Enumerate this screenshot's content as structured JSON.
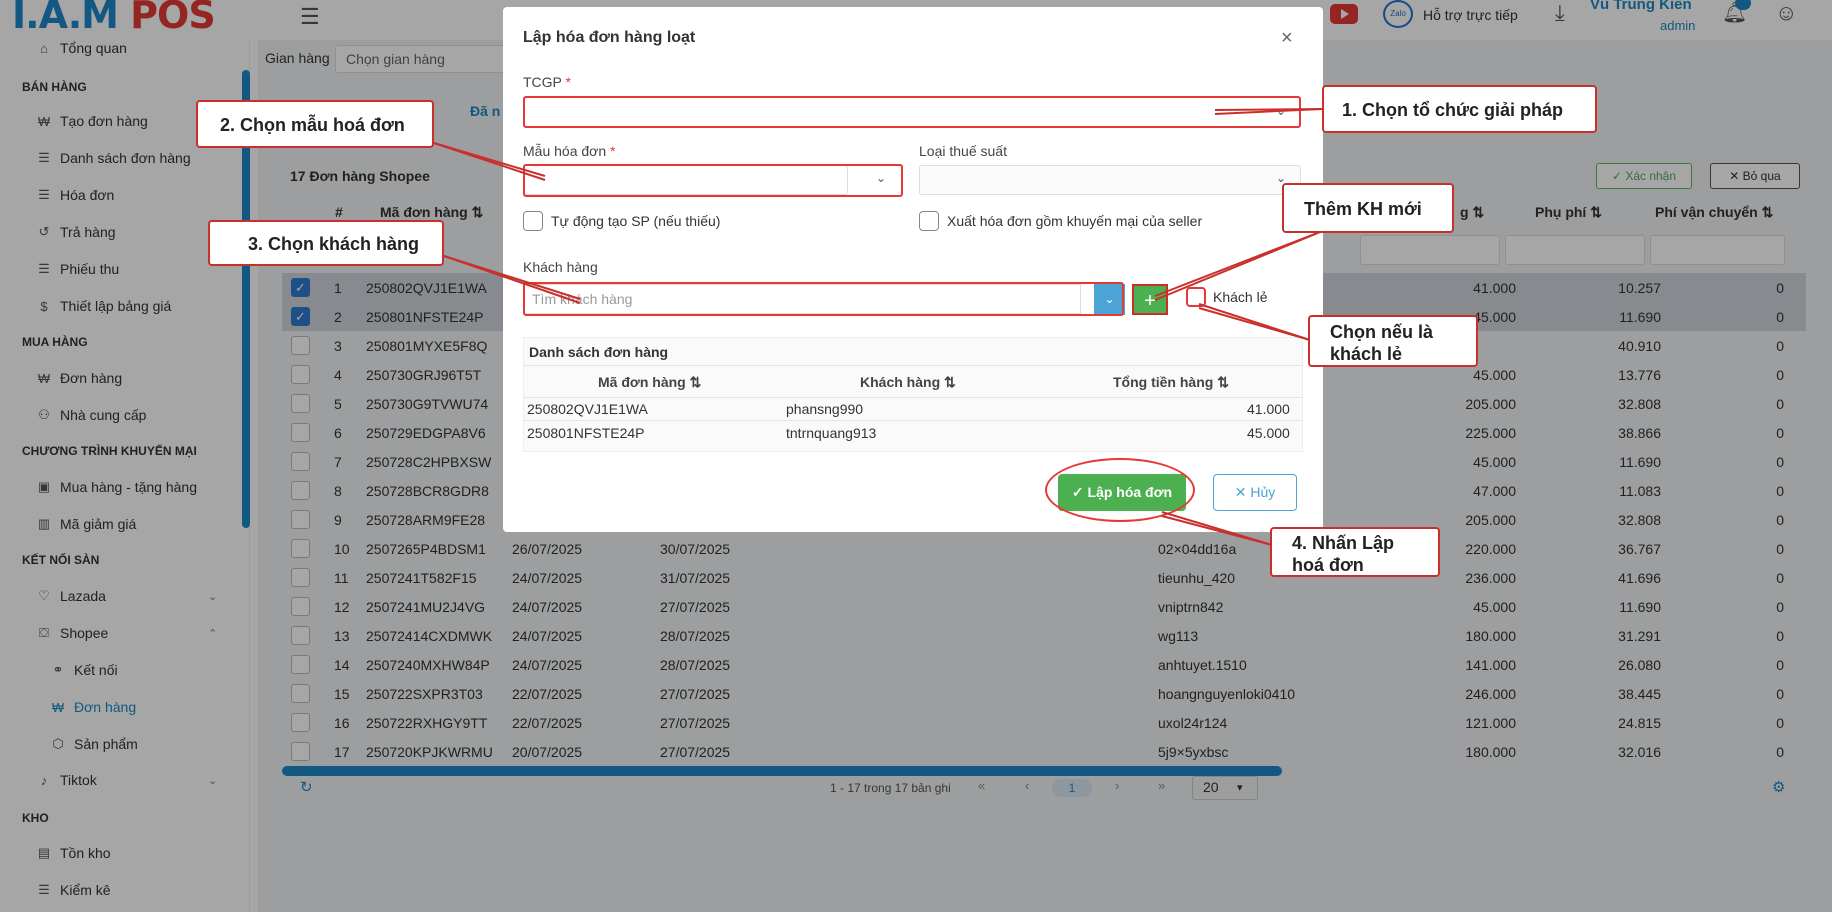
{
  "topbar": {
    "logo_a": "I.A.M",
    "logo_b": " POS",
    "zalo": "Zalo",
    "support": "Hỗ trợ trực tiếp",
    "user_name": "Vũ Trung Kiên",
    "user_role": "admin"
  },
  "sidebar": {
    "truncated_top": "Tổng quan",
    "sections": {
      "ban_hang": "BÁN HÀNG",
      "mua_hang": "MUA HÀNG",
      "khuyen_mai": "CHƯƠNG TRÌNH KHUYẾN MẠI",
      "ket_noi_san": "KẾT NỐI SÀN",
      "kho": "KHO"
    },
    "items": {
      "tao_don": "Tạo đơn hàng",
      "ds_don": "Danh sách đơn hàng",
      "hoa_don": "Hóa đơn",
      "tra_hang": "Trả hàng",
      "phieu_thu": "Phiếu thu",
      "bang_gia": "Thiết lập bảng giá",
      "don_hang_mua": "Đơn hàng",
      "ncc": "Nhà cung cấp",
      "tang_hang": "Mua hàng - tặng hàng",
      "giam_gia": "Mã giảm giá",
      "lazada": "Lazada",
      "shopee": "Shopee",
      "ket_noi": "Kết nối",
      "don_hang_shopee": "Đơn hàng",
      "san_pham": "Sản phẩm",
      "tiktok": "Tiktok",
      "ton_kho": "Tồn kho",
      "kiem_ke": "Kiểm kê"
    }
  },
  "main": {
    "gian_hang_label": "Gian hàng",
    "gian_hang_placeholder": "Chọn gian hàng",
    "tab_partial": "Đã n",
    "count_title": "17 Đơn hàng Shopee",
    "confirm_btn": "✓ Xác nhận",
    "skip_btn": "✕ Bỏ qua",
    "headers": {
      "stt": "#",
      "ma_don": "Mã đơn hàng ⇅",
      "tong_tien_partial": "g ⇅",
      "phu_phi": "Phụ phí ⇅",
      "van_chuyen": "Phí vận chuyển ⇅"
    },
    "rows": [
      {
        "n": "1",
        "ma": "250802QVJ1E1WA",
        "d1": "",
        "d2": "",
        "kh": "",
        "tt": "41.000",
        "pp": "10.257",
        "vc": "0"
      },
      {
        "n": "2",
        "ma": "250801NFSTE24P",
        "d1": "",
        "d2": "",
        "kh": "",
        "tt": "45.000",
        "pp": "11.690",
        "vc": "0"
      },
      {
        "n": "3",
        "ma": "250801MYXE5F8Q",
        "d1": "",
        "d2": "",
        "kh": "",
        "tt": "",
        "pp": "40.910",
        "vc": "0"
      },
      {
        "n": "4",
        "ma": "250730GRJ96T5T",
        "d1": "",
        "d2": "",
        "kh": "",
        "tt": "45.000",
        "pp": "13.776",
        "vc": "0"
      },
      {
        "n": "5",
        "ma": "250730G9TVWU74",
        "d1": "",
        "d2": "",
        "kh": "",
        "tt": "205.000",
        "pp": "32.808",
        "vc": "0"
      },
      {
        "n": "6",
        "ma": "250729EDGPA8V6",
        "d1": "",
        "d2": "",
        "kh": "",
        "tt": "225.000",
        "pp": "38.866",
        "vc": "0"
      },
      {
        "n": "7",
        "ma": "250728C2HPBXSW",
        "d1": "",
        "d2": "",
        "kh": "",
        "tt": "45.000",
        "pp": "11.690",
        "vc": "0"
      },
      {
        "n": "8",
        "ma": "250728BCR8GDR8",
        "d1": "",
        "d2": "",
        "kh": "",
        "tt": "47.000",
        "pp": "11.083",
        "vc": "0"
      },
      {
        "n": "9",
        "ma": "250728ARM9FE28",
        "d1": "",
        "d2": "",
        "kh": "",
        "tt": "205.000",
        "pp": "32.808",
        "vc": "0"
      },
      {
        "n": "10",
        "ma": "2507265P4BDSM1",
        "d1": "26/07/2025",
        "d2": "30/07/2025",
        "kh": "02×04dd16a",
        "tt": "220.000",
        "pp": "36.767",
        "vc": "0"
      },
      {
        "n": "11",
        "ma": "2507241T582F15",
        "d1": "24/07/2025",
        "d2": "31/07/2025",
        "kh": "tieunhu_420",
        "tt": "236.000",
        "pp": "41.696",
        "vc": "0"
      },
      {
        "n": "12",
        "ma": "2507241MU2J4VG",
        "d1": "24/07/2025",
        "d2": "27/07/2025",
        "kh": "vniptrn842",
        "tt": "45.000",
        "pp": "11.690",
        "vc": "0"
      },
      {
        "n": "13",
        "ma": "25072414CXDMWK",
        "d1": "24/07/2025",
        "d2": "28/07/2025",
        "kh": "wg113",
        "tt": "180.000",
        "pp": "31.291",
        "vc": "0"
      },
      {
        "n": "14",
        "ma": "2507240MXHW84P",
        "d1": "24/07/2025",
        "d2": "28/07/2025",
        "kh": "anhtuyet.1510",
        "tt": "141.000",
        "pp": "26.080",
        "vc": "0"
      },
      {
        "n": "15",
        "ma": "250722SXPR3T03",
        "d1": "22/07/2025",
        "d2": "27/07/2025",
        "kh": "hoangnguyenloki0410",
        "tt": "246.000",
        "pp": "38.445",
        "vc": "0"
      },
      {
        "n": "16",
        "ma": "250722RXHGY9TT",
        "d1": "22/07/2025",
        "d2": "27/07/2025",
        "kh": "uxol24r124",
        "tt": "121.000",
        "pp": "24.815",
        "vc": "0"
      },
      {
        "n": "17",
        "ma": "250720KPJKWRMU",
        "d1": "20/07/2025",
        "d2": "27/07/2025",
        "kh": "5j9×5yxbsc",
        "tt": "180.000",
        "pp": "32.016",
        "vc": "0"
      }
    ],
    "pager_text": "1 - 17 trong 17 bản ghi",
    "pager_first": "«",
    "pager_prev": "‹",
    "pager_current": "1",
    "pager_next": "›",
    "pager_last": "»",
    "page_size": "20"
  },
  "modal": {
    "title": "Lập hóa đơn hàng loạt",
    "tcgp_label": "TCGP",
    "mau_label": "Mẫu hóa đơn",
    "thue_label": "Loại thuế suất",
    "auto_sp": "Tự động tạo SP (nếu thiếu)",
    "xuat_km": "Xuất hóa đơn gồm khuyến mại của seller",
    "kh_label": "Khách hàng",
    "kh_placeholder": "Tìm khách hàng",
    "khach_le": "Khách lẻ",
    "dsl_title": "Danh sách đơn hàng",
    "dsl_headers": [
      "Mã đơn hàng ⇅",
      "Khách hàng ⇅",
      "Tổng tiền hàng ⇅"
    ],
    "dsl_rows": [
      [
        "250802QVJ1E1WA",
        "phansng990",
        "41.000"
      ],
      [
        "250801NFSTE24P",
        "tntrnquang913",
        "45.000"
      ]
    ],
    "create_btn": "✓ Lập hóa đơn",
    "cancel_btn": "✕ Hủy"
  },
  "callouts": {
    "c1": "1. Chọn tổ chức giải pháp",
    "c2": "2. Chọn mẫu hoá đơn",
    "c3": "3. Chọn khách hàng",
    "c_them": "Thêm KH mới",
    "c_le_1": "Chọn nếu là",
    "c_le_2": "khách  lẻ",
    "c4_1": "4. Nhấn Lập",
    "c4_2": "hoá đơn"
  },
  "colors": {
    "brand": "#1e88c8",
    "accent_red": "#e53935",
    "success": "#4caf50"
  }
}
